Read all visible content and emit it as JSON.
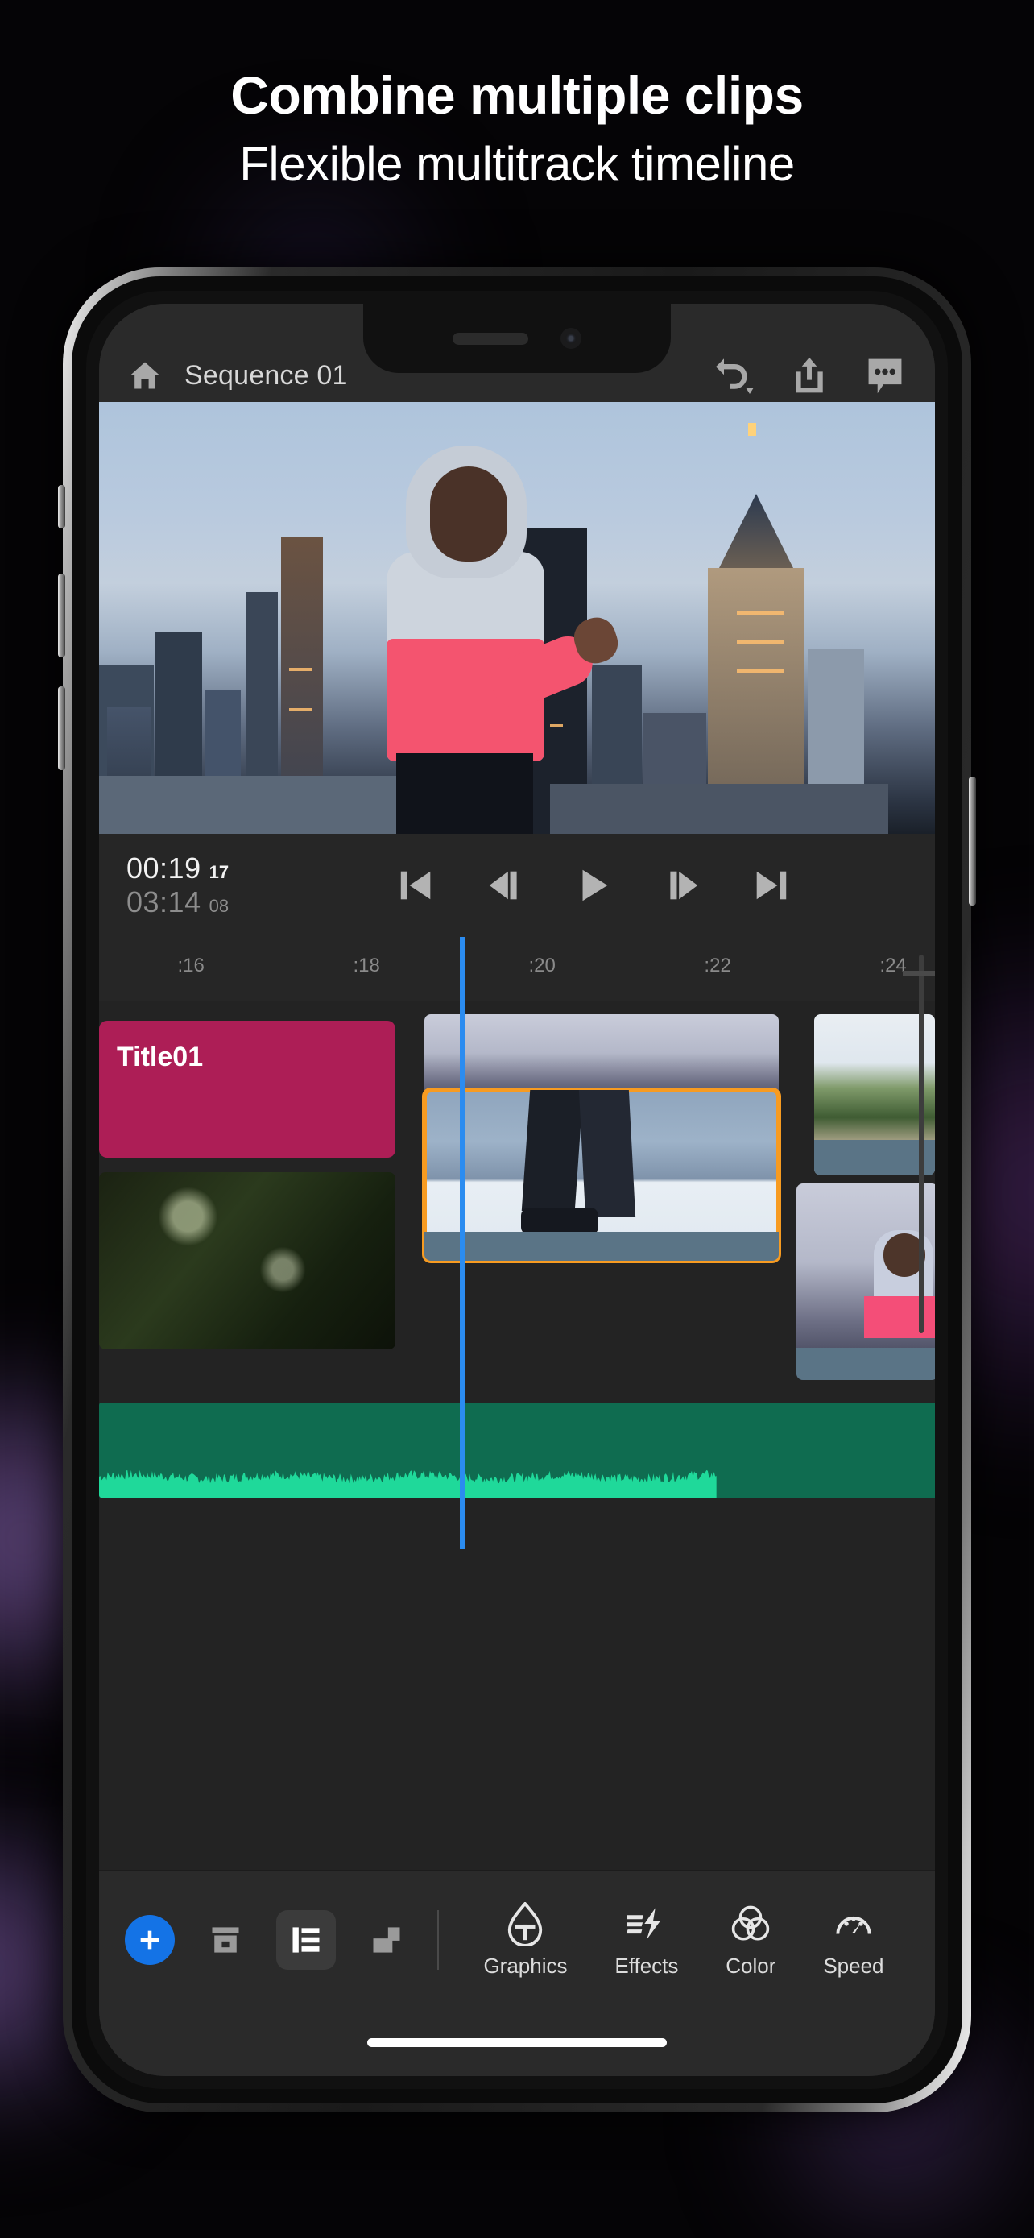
{
  "promo": {
    "headline": "Combine multiple clips",
    "subhead": "Flexible multitrack timeline"
  },
  "colors": {
    "accent_blue": "#1473e6",
    "playhead_blue": "#2b8cf0",
    "selection_orange": "#f79b21",
    "title_clip_magenta": "#ad1e56",
    "audio_green_fill": "#1fd99a",
    "audio_green_bg": "#0f6c50",
    "panel_bg": "#232323",
    "bar_bg": "#2a2a2a"
  },
  "app": {
    "header": {
      "home_icon": "home-icon",
      "sequence_title": "Sequence 01",
      "undo_icon": "undo-dropdown-icon",
      "share_icon": "share-export-icon",
      "comments_icon": "comments-icon"
    },
    "transport": {
      "current_time": "00:19",
      "current_frames": "17",
      "duration_time": "03:14",
      "duration_frames": "08",
      "buttons": [
        {
          "name": "skip-to-start-button",
          "icon": "skip-back-icon"
        },
        {
          "name": "step-back-button",
          "icon": "step-back-icon"
        },
        {
          "name": "play-button",
          "icon": "play-icon"
        },
        {
          "name": "step-forward-button",
          "icon": "step-forward-icon"
        },
        {
          "name": "skip-to-end-button",
          "icon": "skip-forward-icon"
        }
      ]
    },
    "timeline": {
      "ruler_ticks": [
        ":16",
        ":18",
        ":20",
        ":22",
        ":24"
      ],
      "playhead_label": ":20",
      "clips": [
        {
          "name": "title-clip",
          "label": "Title01",
          "kind": "title",
          "selected": false
        },
        {
          "name": "video-clip-city-walk",
          "label": "",
          "kind": "video",
          "selected": true
        },
        {
          "name": "video-clip-city-top",
          "label": "",
          "kind": "video",
          "selected": false
        },
        {
          "name": "video-clip-forest",
          "label": "",
          "kind": "video",
          "selected": false
        },
        {
          "name": "video-clip-lake",
          "label": "",
          "kind": "video",
          "selected": false
        },
        {
          "name": "video-clip-dusk-person",
          "label": "",
          "kind": "video",
          "selected": false
        },
        {
          "name": "audio-clip-music",
          "label": "",
          "kind": "audio",
          "selected": false
        }
      ]
    },
    "bottom_toolbar": {
      "add_button": "+",
      "tools": [
        {
          "name": "add-media-button",
          "icon": "add-icon",
          "active": false
        },
        {
          "name": "media-browser-button",
          "icon": "media-box-icon",
          "active": false
        },
        {
          "name": "timeline-view-button",
          "icon": "timeline-tracks-icon",
          "active": true
        },
        {
          "name": "layers-button",
          "icon": "layers-icon",
          "active": false
        }
      ],
      "tabs": [
        {
          "name": "tab-graphics",
          "label": "Graphics",
          "icon": "graphics-text-icon"
        },
        {
          "name": "tab-effects",
          "label": "Effects",
          "icon": "effects-bolt-icon"
        },
        {
          "name": "tab-color",
          "label": "Color",
          "icon": "color-wheels-icon"
        },
        {
          "name": "tab-speed",
          "label": "Speed",
          "icon": "speed-gauge-icon"
        }
      ]
    }
  },
  "device": {
    "notch_speaker": "speaker-grille",
    "notch_camera": "front-camera",
    "home_indicator": "home-indicator-bar"
  }
}
